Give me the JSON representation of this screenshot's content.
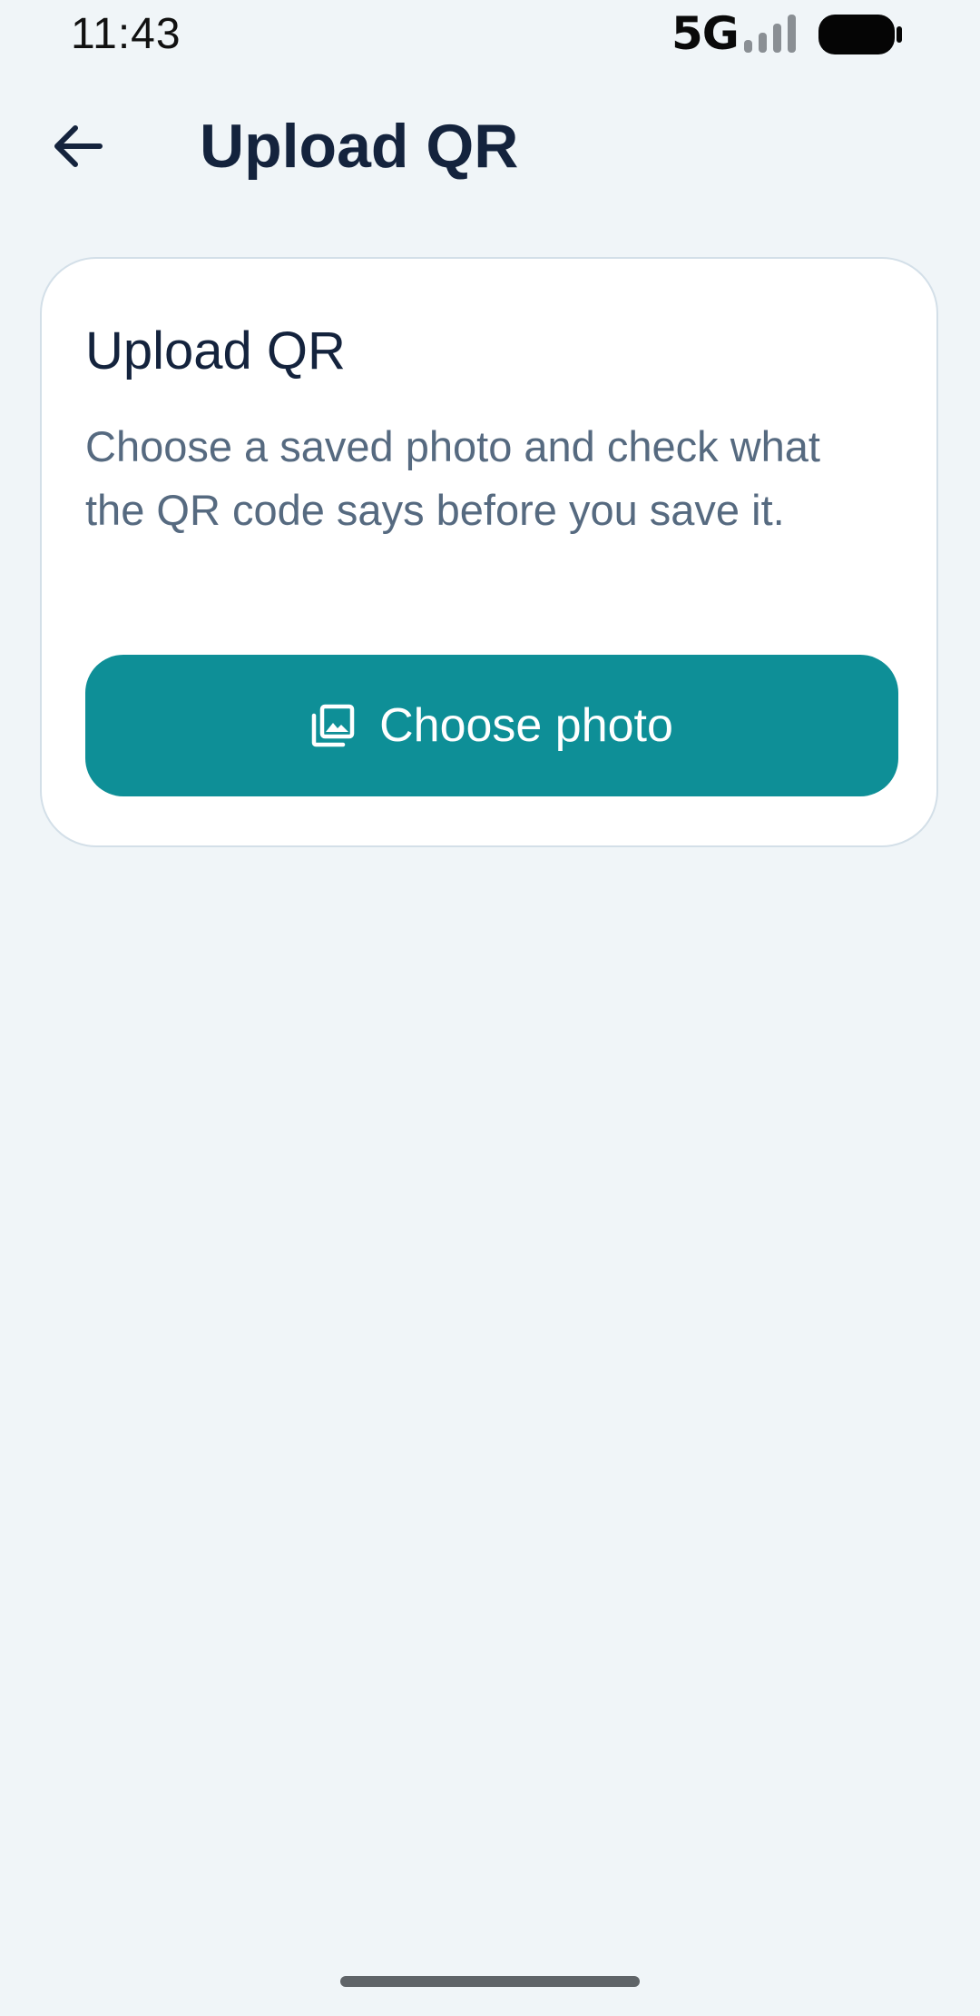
{
  "status_bar": {
    "time": "11:43",
    "network": "5G",
    "signal_icon": "signal-bars-icon",
    "battery_icon": "battery-icon"
  },
  "app_bar": {
    "back_icon": "arrow-back-icon",
    "title": "Upload QR"
  },
  "card": {
    "title": "Upload QR",
    "description": "Choose a saved photo and check what the QR code says before you save it.",
    "button": {
      "icon": "photo-library-icon",
      "label": "Choose photo"
    }
  },
  "colors": {
    "background": "#f0f5f8",
    "card": "#ffffff",
    "primary": "#0e8f97",
    "title_text": "#14233d",
    "body_text": "#566a80"
  }
}
